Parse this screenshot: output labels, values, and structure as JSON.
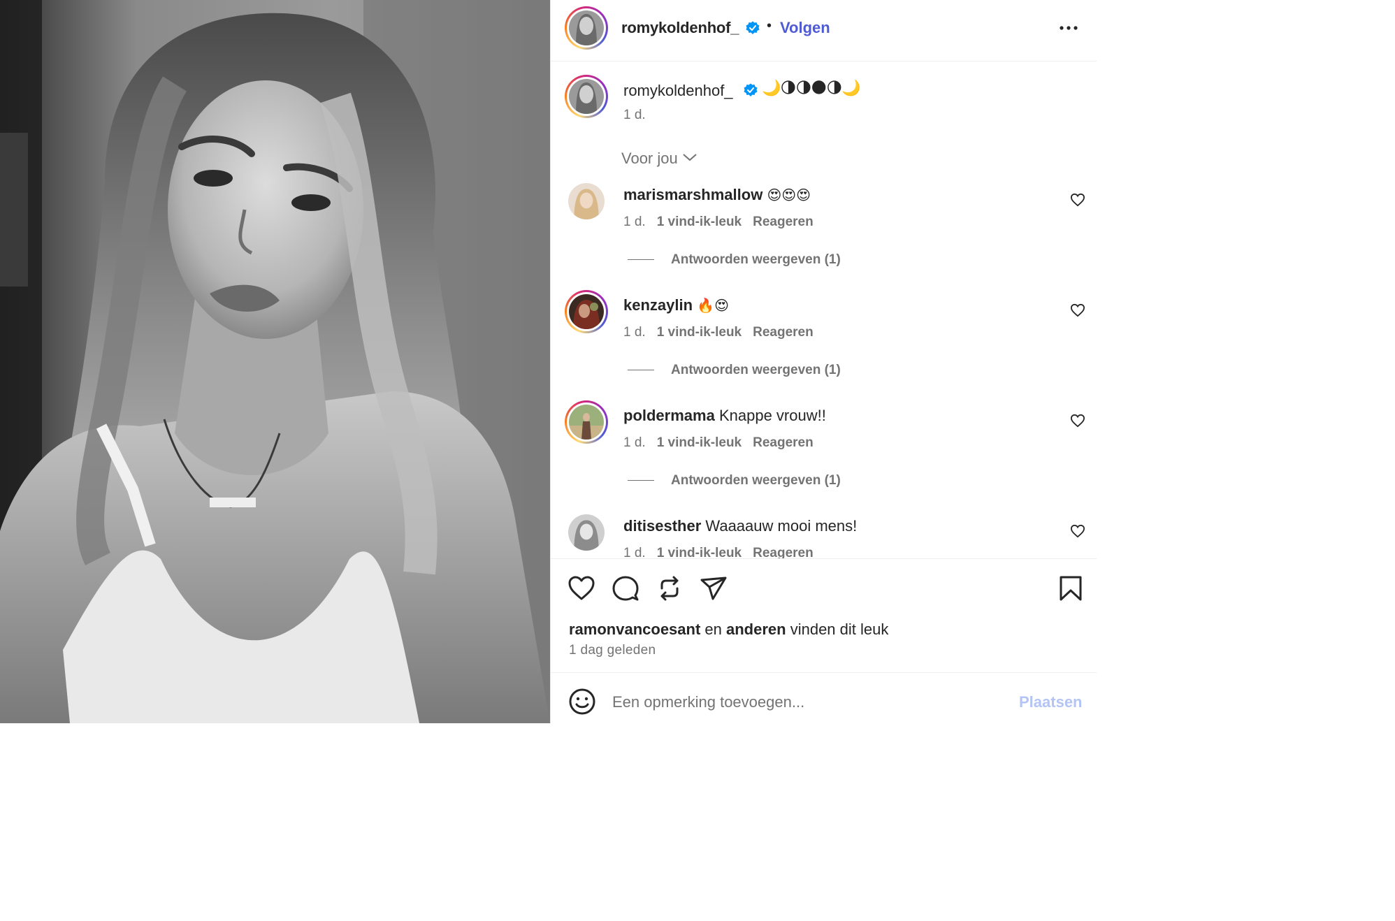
{
  "post": {
    "author": "romykoldenhof_",
    "follow_label": "Volgen",
    "separator": "•",
    "caption_emoji": "🌙🌗🌗🌑🌗🌙",
    "caption_time": "1 d.",
    "sort_label": "Voor jou"
  },
  "comments": [
    {
      "user": "marismarshmallow",
      "text": "",
      "emoji": "😍😍😍",
      "time": "1 d.",
      "likes": "1 vind-ik-leuk",
      "reply": "Reageren",
      "replies": "Antwoorden weergeven (1)"
    },
    {
      "user": "kenzaylin",
      "text": "",
      "emoji": "🔥😍",
      "time": "1 d.",
      "likes": "1 vind-ik-leuk",
      "reply": "Reageren",
      "replies": "Antwoorden weergeven (1)"
    },
    {
      "user": "poldermama",
      "text": "Knappe vrouw!!",
      "emoji": "",
      "time": "1 d.",
      "likes": "1 vind-ik-leuk",
      "reply": "Reageren",
      "replies": "Antwoorden weergeven (1)"
    },
    {
      "user": "ditisesther",
      "text": "Waaaauw mooi mens!",
      "emoji": "",
      "time": "1 d.",
      "likes": "1 vind-ik-leuk",
      "reply": "Reageren",
      "replies": ""
    }
  ],
  "likes_summary": {
    "first_user": "ramonvancoesant",
    "connector": " en ",
    "others": "anderen",
    "suffix": " vinden dit leuk",
    "time": "1 dag geleden"
  },
  "add_comment": {
    "placeholder": "Een opmerking toevoegen...",
    "post_label": "Plaatsen"
  },
  "colors": {
    "follow_blue": "#4f5bd5",
    "verified_blue": "#0095f6",
    "muted": "#737373",
    "post_disabled": "#b3c4f5"
  }
}
